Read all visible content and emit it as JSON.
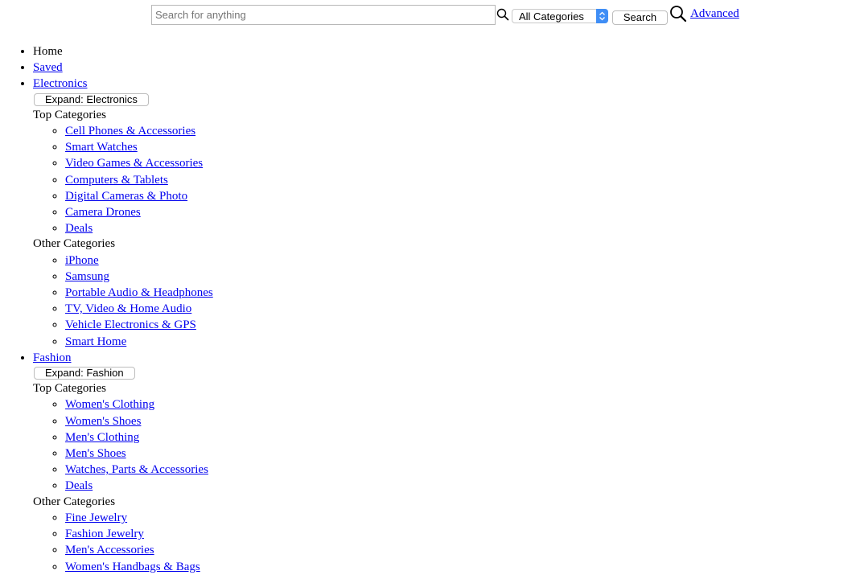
{
  "header": {
    "search_placeholder": "Search for anything",
    "category_selected": "All Categories",
    "search_button": "Search",
    "advanced_link": "Advanced"
  },
  "nav": {
    "home": "Home",
    "saved": "Saved",
    "electronics": {
      "label": "Electronics",
      "expand_button": "Expand: Electronics",
      "top_heading": "Top Categories",
      "top": [
        "Cell Phones & Accessories",
        "Smart Watches",
        "Video Games & Accessories",
        "Computers & Tablets",
        "Digital Cameras & Photo",
        "Camera Drones",
        "Deals"
      ],
      "other_heading": "Other Categories",
      "other": [
        "iPhone",
        "Samsung",
        "Portable Audio & Headphones",
        "TV, Video & Home Audio",
        "Vehicle Electronics & GPS",
        "Smart Home"
      ]
    },
    "fashion": {
      "label": "Fashion",
      "expand_button": "Expand: Fashion",
      "top_heading": "Top Categories",
      "top": [
        "Women's Clothing",
        "Women's Shoes",
        "Men's Clothing",
        "Men's Shoes",
        "Watches, Parts & Accessories",
        "Deals"
      ],
      "other_heading": "Other Categories",
      "other": [
        "Fine Jewelry",
        "Fashion Jewelry",
        "Men's Accessories",
        "Women's Handbags & Bags"
      ]
    }
  },
  "colors": {
    "link": "#0000ee",
    "select_accent": "#3f8ef6"
  }
}
